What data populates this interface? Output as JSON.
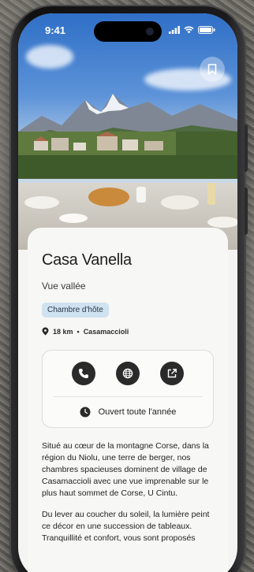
{
  "status_bar": {
    "time": "9:41"
  },
  "listing": {
    "name": "Casa Vanella",
    "subtitle": "Vue vallée",
    "category_tag": "Chambre d'hôte",
    "distance": "18 km",
    "separator": "•",
    "town": "Casamaccioli",
    "opening": "Ouvert toute l'année",
    "description": [
      "Situé au cœur de la montagne Corse, dans la région du Niolu, une terre de berger, nos chambres spacieuses dominent de village de Casamaccioli avec une vue imprenable sur le plus haut sommet de Corse, U Cintu.",
      "Du lever au coucher du soleil, la lumière peint ce décor en une succession de tableaux. Tranquillité et confort, vous sont proposés"
    ]
  },
  "icons": {
    "bookmark": "bookmark-icon",
    "location": "map-pin-icon",
    "phone": "phone-icon",
    "web": "globe-icon",
    "external": "external-link-icon",
    "clock": "clock-icon"
  },
  "colors": {
    "tag_bg": "#cfe2ef",
    "action_bg": "#2a2a2a",
    "sheet_bg": "#f7f7f5"
  }
}
